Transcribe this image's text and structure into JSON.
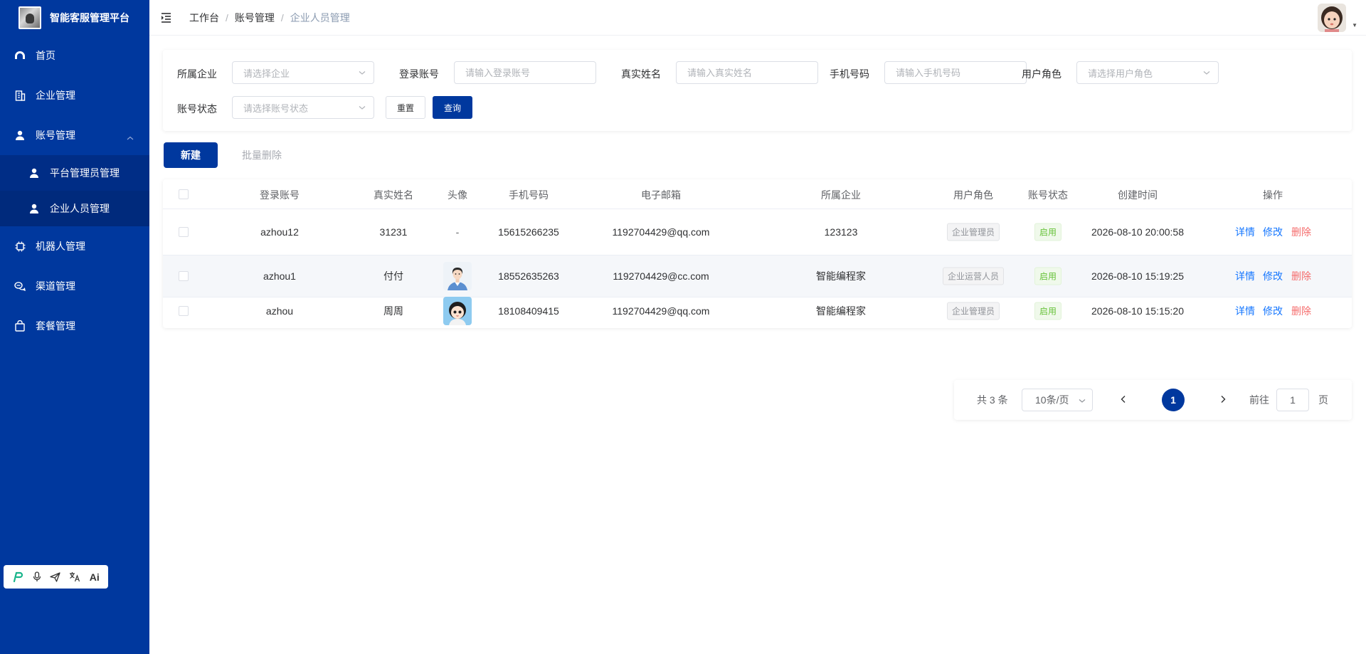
{
  "app": {
    "title": "智能客服管理平台"
  },
  "sidebar": {
    "items": [
      {
        "label": "首页",
        "icon": "dashboard-icon"
      },
      {
        "label": "企业管理",
        "icon": "building-icon"
      },
      {
        "label": "账号管理",
        "icon": "user-icon",
        "expanded": true,
        "children": [
          {
            "label": "平台管理员管理",
            "icon": "user-icon"
          },
          {
            "label": "企业人员管理",
            "icon": "user-icon",
            "active": true
          }
        ]
      },
      {
        "label": "机器人管理",
        "icon": "chip-icon"
      },
      {
        "label": "渠道管理",
        "icon": "channel-icon"
      },
      {
        "label": "套餐管理",
        "icon": "bag-icon"
      }
    ]
  },
  "header": {
    "breadcrumb": [
      "工作台",
      "账号管理",
      "企业人员管理"
    ]
  },
  "filters": {
    "company": {
      "label": "所属企业",
      "placeholder": "请选择企业"
    },
    "account": {
      "label": "登录账号",
      "placeholder": "请输入登录账号"
    },
    "realname": {
      "label": "真实姓名",
      "placeholder": "请输入真实姓名"
    },
    "phone": {
      "label": "手机号码",
      "placeholder": "请输入手机号码"
    },
    "role": {
      "label": "用户角色",
      "placeholder": "请选择用户角色"
    },
    "status": {
      "label": "账号状态",
      "placeholder": "请选择账号状态"
    },
    "reset_label": "重置",
    "query_label": "查询"
  },
  "toolbar": {
    "new_label": "新建",
    "bulk_delete_label": "批量删除"
  },
  "table": {
    "columns": [
      "登录账号",
      "真实姓名",
      "头像",
      "手机号码",
      "电子邮箱",
      "所属企业",
      "用户角色",
      "账号状态",
      "创建时间",
      "操作"
    ],
    "rows": [
      {
        "account": "azhou12",
        "name": "31231",
        "avatar": "-",
        "phone": "15615266235",
        "email": "1192704429@qq.com",
        "company": "123123",
        "role": "企业管理员",
        "status": "启用",
        "created": "2026-08-10 20:00:58"
      },
      {
        "account": "azhou1",
        "name": "付付",
        "avatar": "photo-woman",
        "phone": "18552635263",
        "email": "1192704429@cc.com",
        "company": "智能编程家",
        "role": "企业运营人员",
        "status": "启用",
        "created": "2026-08-10 15:19:25"
      },
      {
        "account": "azhou",
        "name": "周周",
        "avatar": "cartoon-girl",
        "phone": "18108409415",
        "email": "1192704429@qq.com",
        "company": "智能编程家",
        "role": "企业管理员",
        "status": "启用",
        "created": "2026-08-10 15:15:20"
      }
    ],
    "actions": {
      "detail": "详情",
      "edit": "修改",
      "delete": "删除"
    }
  },
  "pagination": {
    "total_label": "共 3 条",
    "page_size": "10条/页",
    "current": "1",
    "goto_label": "前往",
    "goto_value": "1",
    "page_suffix": "页"
  },
  "toolbox": [
    "P",
    "mic",
    "send",
    "translate",
    "Ai"
  ],
  "colors": {
    "primary": "#00389e",
    "sidebar_bg": "#00389e",
    "link": "#1677ff",
    "danger": "#f56c6c",
    "success": "#67c23a"
  }
}
